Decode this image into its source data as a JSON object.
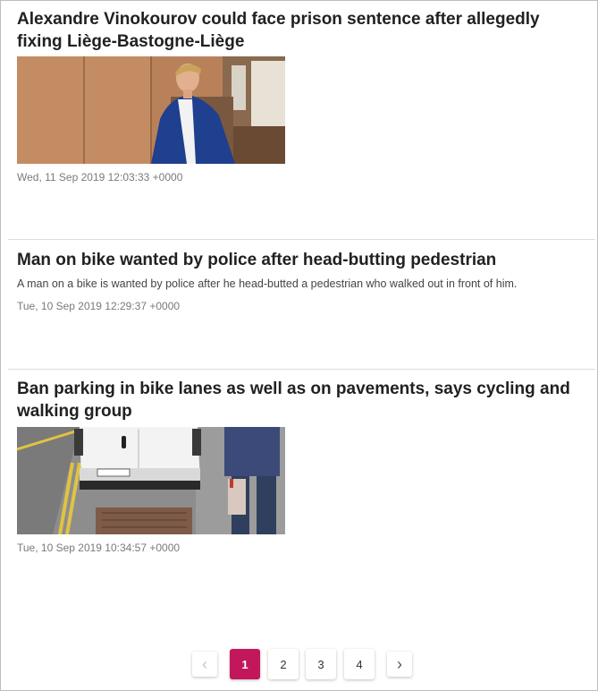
{
  "articles": [
    {
      "title": "Alexandre Vinokourov could face prison sentence after allegedly fixing Liège-Bastogne-Liège",
      "description": "",
      "date": "Wed, 11 Sep 2019 12:03:33 +0000",
      "image": "man-in-blue-suit-photo"
    },
    {
      "title": "Man on bike wanted by police after head-butting pedestrian",
      "description": "A man on a bike is wanted by police after he head-butted a pedestrian who walked out in front of him.",
      "date": "Tue, 10 Sep 2019 12:29:37 +0000",
      "image": ""
    },
    {
      "title": "Ban parking in bike lanes as well as on pavements, says cycling and walking group",
      "description": "",
      "date": "Tue, 10 Sep 2019 10:34:57 +0000",
      "image": "white-van-parked-on-street-photo"
    }
  ],
  "pagination": {
    "prev_icon": "chevron-left-icon",
    "next_icon": "chevron-right-icon",
    "pages": [
      "1",
      "2",
      "3",
      "4"
    ],
    "current": "1",
    "accent_color": "#c2185b"
  }
}
